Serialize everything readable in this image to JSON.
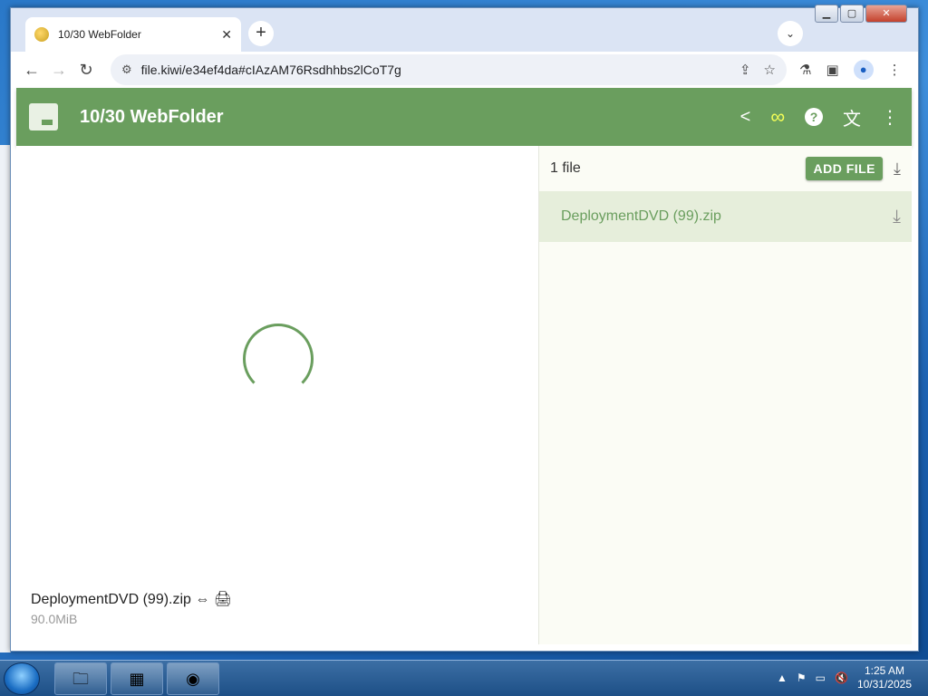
{
  "browser": {
    "tab_title": "10/30 WebFolder",
    "tab_close": "✕",
    "new_tab": "+",
    "tab_search": "⌄",
    "url": "file.kiwi/e34ef4da#cIAzAM76Rsdhhbs2lCoT7g",
    "window_buttons": {
      "minimize": "▁",
      "maximize": "▢",
      "close": "✕"
    }
  },
  "app": {
    "title": "10/30 WebFolder",
    "infinity_glyph": "∞",
    "help_glyph": "?"
  },
  "preview": {
    "file_caption": "DeploymentDVD (99).zip ⇔ 🖨",
    "file_size": "90.0MiB"
  },
  "file_list": {
    "count_label": "1 file",
    "add_file_label": "ADD FILE",
    "files": [
      {
        "name": "DeploymentDVD (99).zip"
      }
    ]
  },
  "taskbar": {
    "time": "1:25 AM",
    "date": "10/31/2025"
  },
  "colors": {
    "accent": "#6a9e5e",
    "infinity": "#f4ff57"
  }
}
